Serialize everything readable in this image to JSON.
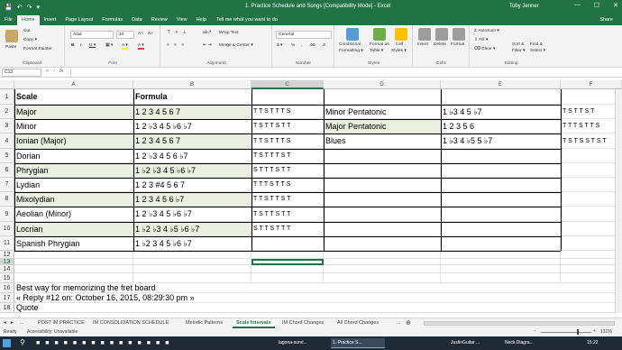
{
  "window": {
    "title": "1. Practice Schedule and Songs  [Compatibility Mode]  -  Excel",
    "user": "Toby Jenner",
    "controls": [
      "—",
      "☐",
      "✕"
    ]
  },
  "qat": {
    "save": "💾",
    "undo": "↶",
    "redo": "↷",
    "more": "▾"
  },
  "tabs": [
    "File",
    "Home",
    "Insert",
    "Page Layout",
    "Formulas",
    "Data",
    "Review",
    "View",
    "Help"
  ],
  "active_tab": "Home",
  "tell_me": "Tell me what you want to do",
  "share": "Share",
  "ribbon": {
    "clipboard": {
      "label": "Clipboard",
      "paste": "Paste",
      "cut": "Cut",
      "copy": "Copy ▾",
      "format_painter": "Format Painter"
    },
    "font": {
      "label": "Font",
      "name": "Arial",
      "size": "10",
      "grow": "A˄",
      "shrink": "A˅",
      "bold": "B",
      "italic": "I",
      "underline": "U ▾",
      "border": "▦ ▾",
      "fill": "A ▾",
      "color": "A ▾"
    },
    "alignment": {
      "label": "Alignment",
      "wrap": "Wrap Text",
      "merge": "Merge & Center ▾"
    },
    "number": {
      "label": "Number",
      "format": "General",
      "currency": "$ ▾",
      "percent": "%",
      "comma": " ,",
      "inc": ".00",
      "dec": ".0"
    },
    "styles": {
      "label": "Styles",
      "conditional": "Conditional",
      "conditional2": "Formatting ▾",
      "table": "Format as",
      "table2": "Table ▾",
      "cell": "Cell",
      "cell2": "Styles ▾"
    },
    "cells": {
      "label": "Cells",
      "insert": "Insert",
      "delete": "Delete",
      "format": "Format"
    },
    "editing": {
      "label": "Editing",
      "autosum": "AutoSum ▾",
      "fill": "Fill ▾",
      "clear": "Clear ▾",
      "sort": "Sort &",
      "sort2": "Filter ▾",
      "find": "Find &",
      "find2": "Select ▾"
    }
  },
  "formula_bar": {
    "name_box": "C13",
    "fx": "fx",
    "cancel": "✕",
    "enter": "✓",
    "value": ""
  },
  "columns": [
    "A",
    "B",
    "C",
    "D",
    "E",
    "F"
  ],
  "selected_column": "C",
  "rows": [
    "1",
    "2",
    "3",
    "4",
    "5",
    "6",
    "7",
    "8",
    "9",
    "10",
    "11",
    "12",
    "13",
    "14",
    "15",
    "16",
    "17",
    "18"
  ],
  "selected_row": "13",
  "cells": {
    "A1": "Scale",
    "B1": "Formula",
    "A2": "Major",
    "B2": "1 2 3 4 5 6 7",
    "C2": "T T S T T T S",
    "D2": "Minor Pentatonic",
    "E2": "1 ♭3 4 5 ♭7",
    "F2": "T S T T S T",
    "A3": "Minor",
    "B3": "1 2 ♭3 4 5 ♭6 ♭7",
    "C3": "T S T T S T T",
    "D3": "Major Pentatonic",
    "E3": "1 2 3 5 6",
    "F3": "T T T S T T S",
    "A4": "Ionian (Major)",
    "B4": "1 2 3 4 5 6 7",
    "C4": "T T S T T T S",
    "D4": "Blues",
    "E4": "1 ♭3 4 ♭5 5 ♭7",
    "F4": "T S T S S T S T",
    "A5": "Dorian",
    "B5": "1 2 ♭3 4 5 6 ♭7",
    "C5": "T S T T T S T",
    "A6": "Phrygian",
    "B6": "1 ♭2 ♭3 4 5 ♭6 ♭7",
    "C6": "S T T T S T T",
    "A7": "Lydian",
    "B7": "1 2 3 #4 5 6 7",
    "C7": "T T T S T T S",
    "A8": "Mixolydian",
    "B8": "1 2 3 4 5 6 ♭7",
    "C8": "T T S T T S T",
    "A9": "Aeolian (Minor)",
    "B9": "1 2 ♭3 4 5 ♭6 ♭7",
    "C9": "T S T T S T T",
    "A10": "Locrian",
    "B10": "1 ♭2 ♭3 4 ♭5 ♭6 ♭7",
    "C10": "S T T S T T T",
    "A11": "Spanish Phrygian",
    "B11": "1 ♭2 3 4 5 ♭6 ♭7",
    "A16": "Best way for memorizing the fret board",
    "A17": "« Reply #12 on: October 16, 2015, 08:29:30 pm »",
    "A18": "Quote"
  },
  "sheet_tabs": [
    "POST IM PRACTICE",
    "IM CONSOLIDATION SCHEDULE",
    "Melodic Patterns",
    "Scale Intervals",
    "IM Chord Changes",
    "All Chord Changes"
  ],
  "active_sheet": "Scale Intervals",
  "sheet_nav": {
    "prev": "◂",
    "next": "▸",
    "more": "...",
    "add": "⊕"
  },
  "status": {
    "ready": "Ready",
    "accessibility": "Accessibility: Unavailable",
    "zoom": "131%",
    "zoom_minus": "−",
    "zoom_plus": "+"
  },
  "taskbar": {
    "items": [
      "lagona-sunri...",
      "1. Practice S...",
      "JustinGuitar ...",
      "Neck Diagra..."
    ],
    "active_item": "1. Practice S...",
    "time": "15:22"
  },
  "colors": {
    "accent": "#217346",
    "shade": "#eaefe0",
    "taskbar": "#1f2a36"
  }
}
